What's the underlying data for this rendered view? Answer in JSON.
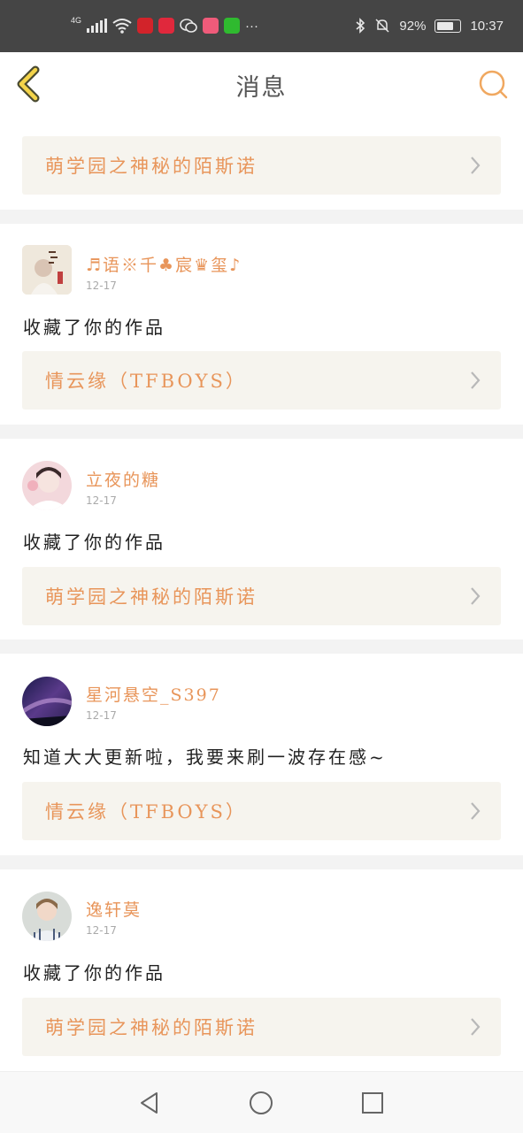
{
  "statusbar": {
    "network": "4G",
    "more": "···",
    "battery": "92%",
    "time": "10:37"
  },
  "header": {
    "title": "消息",
    "back_icon": "chevron-left-icon",
    "search_icon": "search-icon"
  },
  "clipped_text": "··· ··· ·",
  "colors": {
    "accent": "#e8955a",
    "card_bg": "#f6f4ee",
    "divider": "#f3f3f3"
  },
  "top_card": {
    "work_title": "萌学园之神秘的陌斯诺"
  },
  "notifications": [
    {
      "username": "♬语※千♣宸♛玺♪",
      "date": "12-17",
      "message": "收藏了你的作品",
      "work_title": "情云缘（TFBOYS）"
    },
    {
      "username": "立夜的糖",
      "date": "12-17",
      "message": "收藏了你的作品",
      "work_title": "萌学园之神秘的陌斯诺"
    },
    {
      "username": "星河悬空_S397",
      "date": "12-17",
      "message": "知道大大更新啦，我要来刷一波存在感~",
      "work_title": "情云缘（TFBOYS）"
    },
    {
      "username": "逸轩莫",
      "date": "12-17",
      "message": "收藏了你的作品",
      "work_title": "萌学园之神秘的陌斯诺"
    }
  ],
  "system_nav": {
    "back": "back-triangle-icon",
    "home": "home-circle-icon",
    "recents": "recents-square-icon"
  }
}
